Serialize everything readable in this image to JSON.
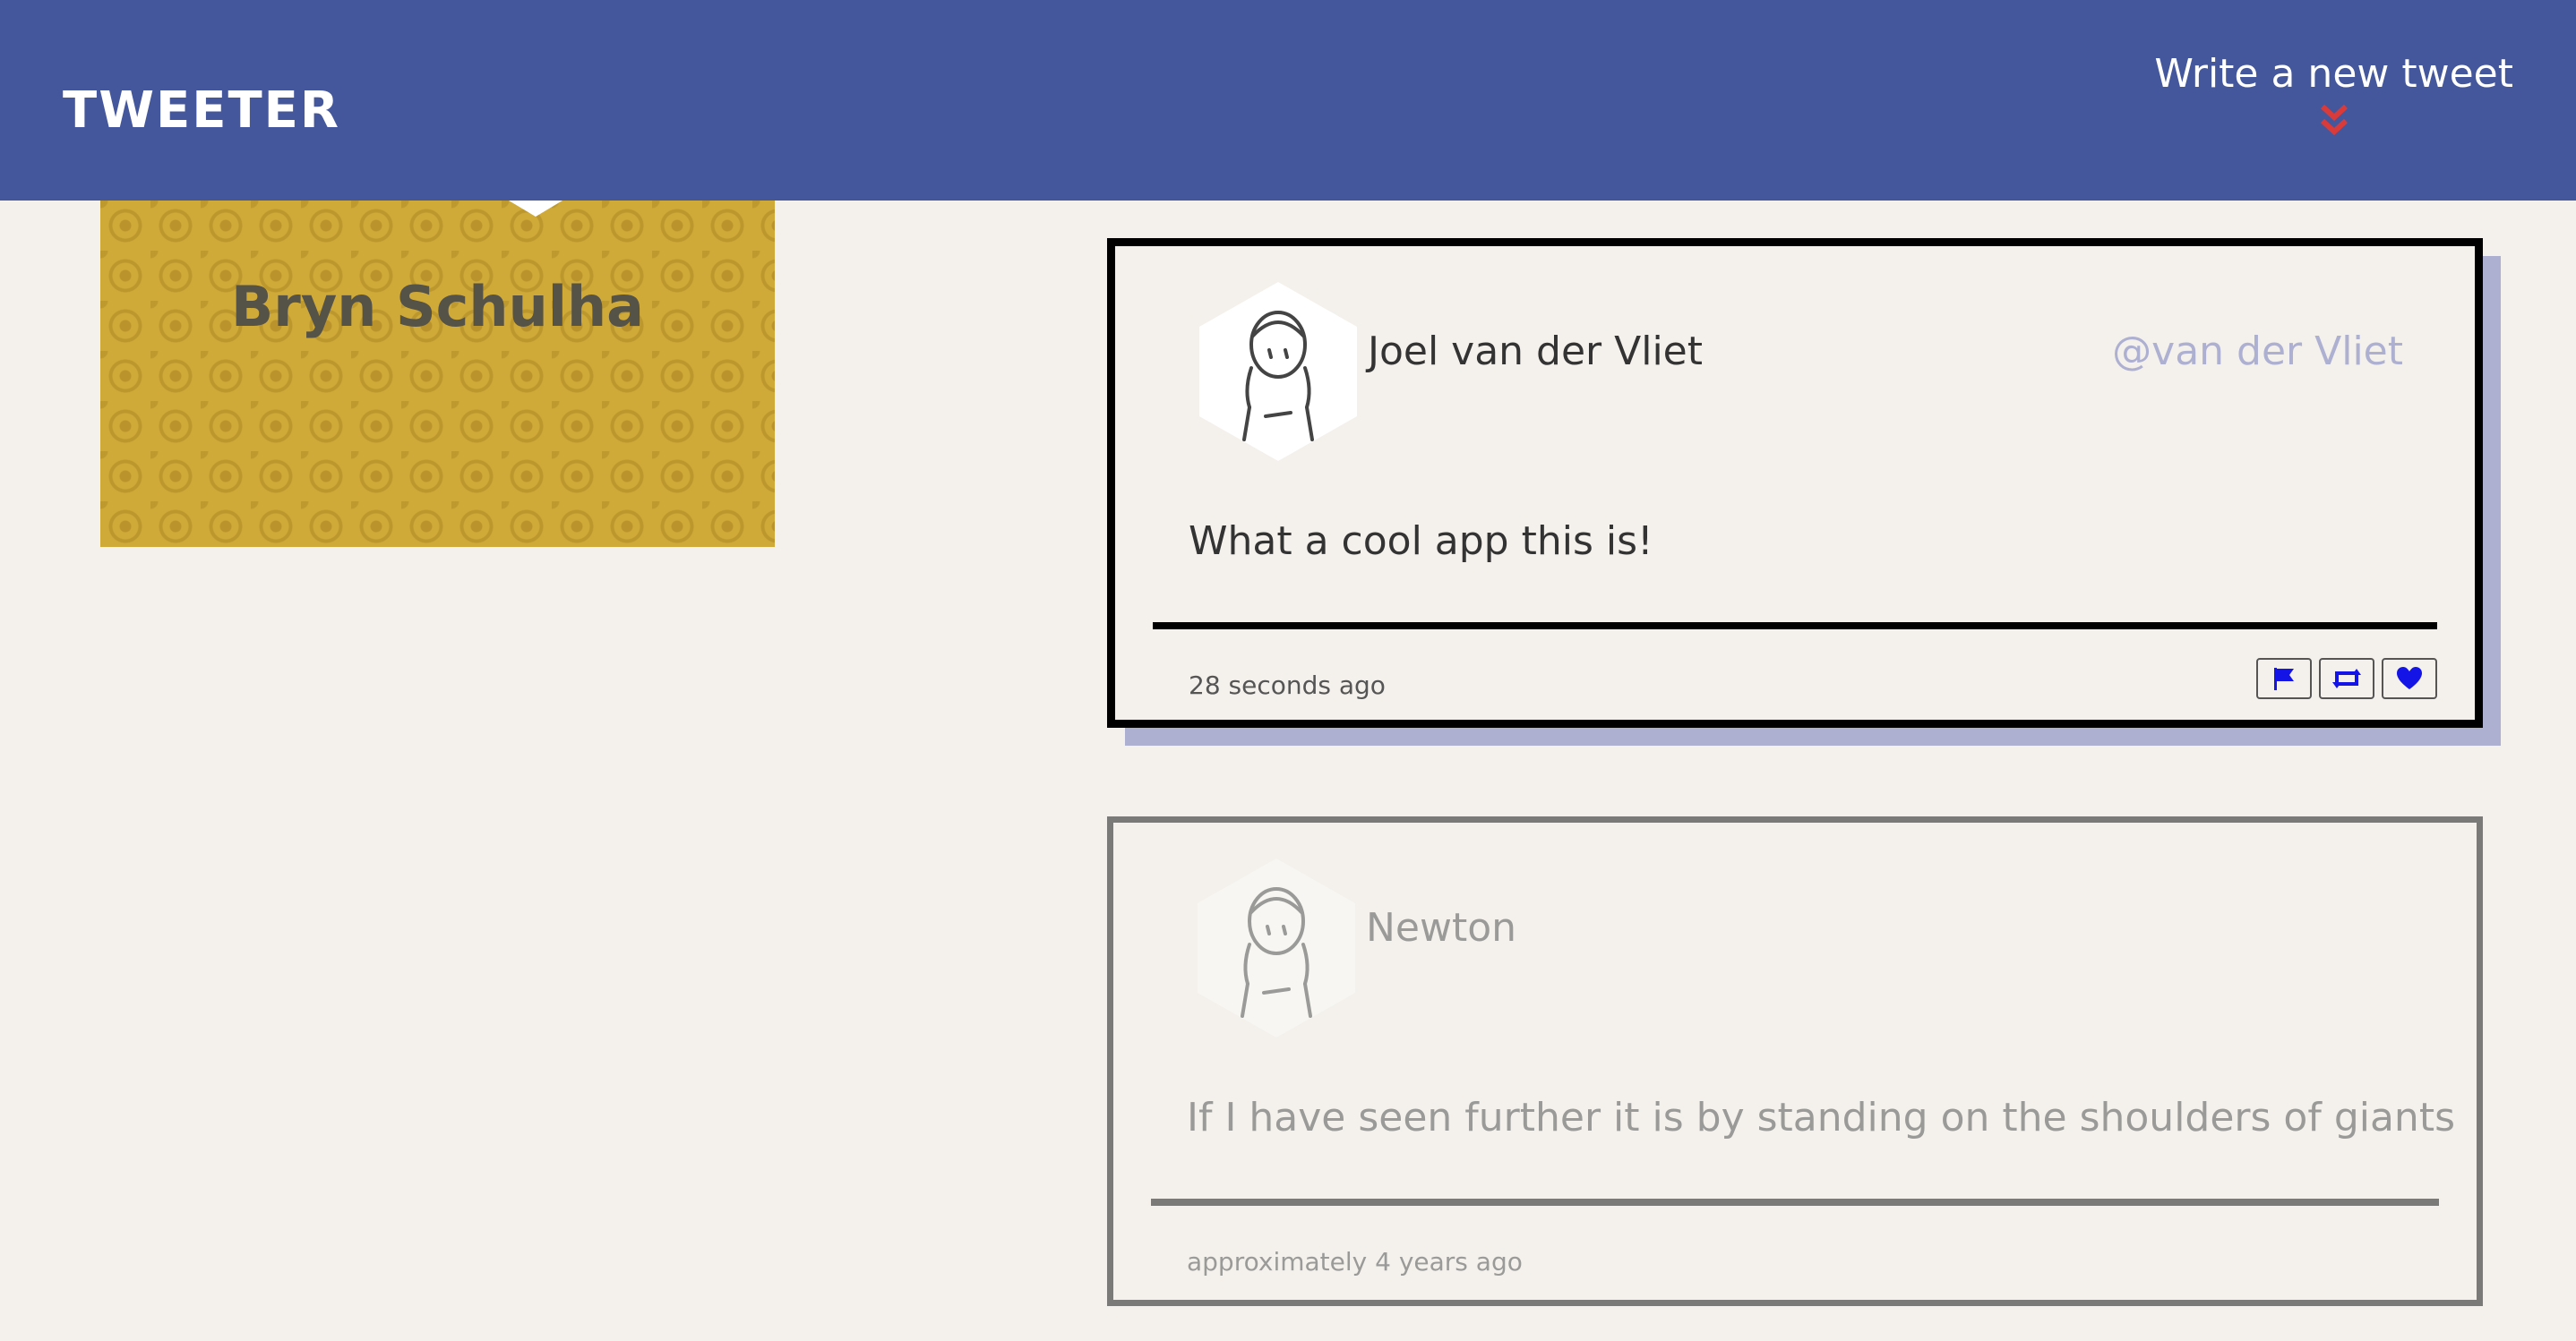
{
  "header": {
    "brand": "TWEETER",
    "compose_label": "Write a new tweet",
    "compose_icon": "double-chevron-down-icon",
    "bar_color": "#44579c",
    "accent_color": "#d93a3a"
  },
  "profile": {
    "name": "Bryn Schulha",
    "card_color": "#d0aa38"
  },
  "tweets": [
    {
      "name": "Joel van der Vliet",
      "handle": "@van der Vliet",
      "text": "What a cool app this is!",
      "timestamp": "28 seconds ago",
      "avatar_icon": "user-avatar-icon",
      "actions": [
        "flag-icon",
        "retweet-icon",
        "heart-icon"
      ]
    },
    {
      "name": "Newton",
      "text": "If I have seen further it is by standing on the shoulders of giants",
      "timestamp": "approximately 4 years ago",
      "avatar_icon": "user-avatar-icon"
    }
  ],
  "colors": {
    "background": "#f4f1ec",
    "handle": "#aeb0d2",
    "action_blue": "#1414e6"
  }
}
